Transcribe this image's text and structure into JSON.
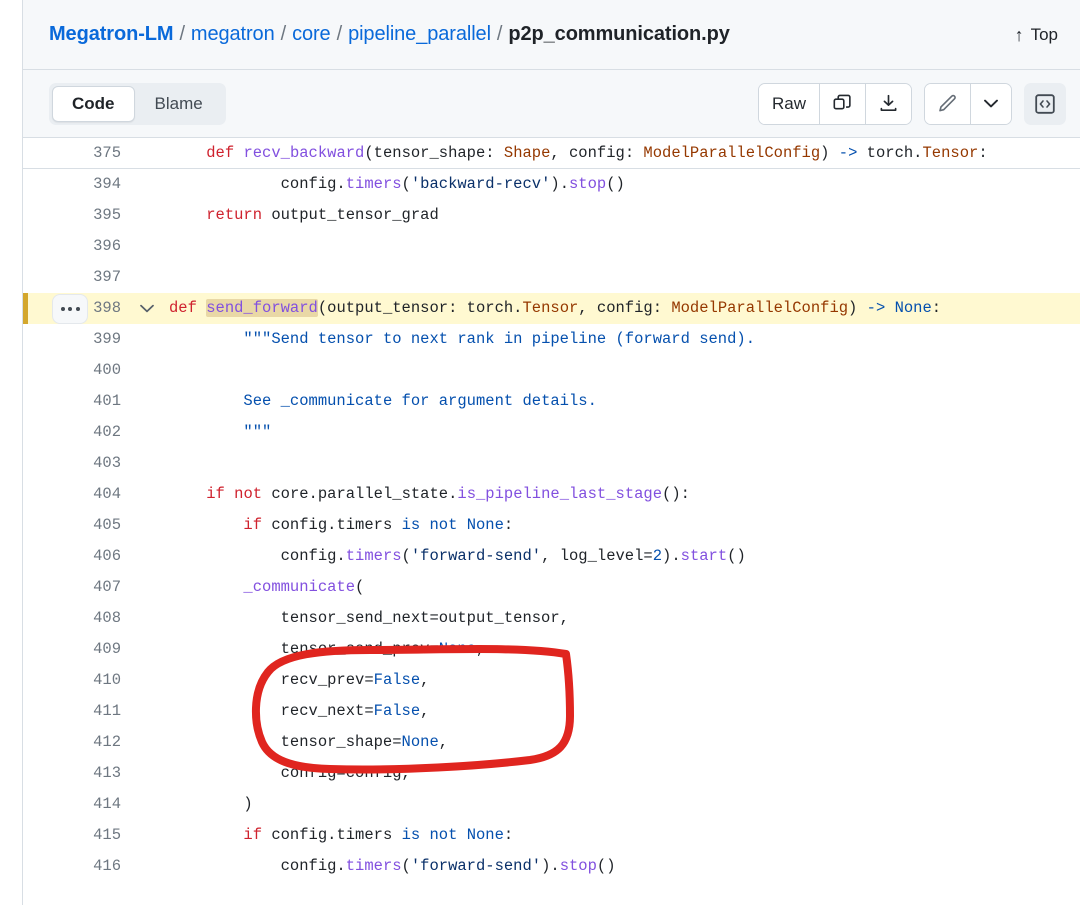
{
  "header": {
    "breadcrumb": {
      "repo": "Megatron-LM",
      "separator": "/",
      "parts": [
        "megatron",
        "core",
        "pipeline_parallel"
      ],
      "file": "p2p_communication.py"
    },
    "top_link": {
      "arrow": "↑",
      "label": "Top",
      "icon": "arrow-up-icon"
    }
  },
  "toolbar": {
    "tabs": [
      {
        "label": "Code",
        "active": true
      },
      {
        "label": "Blame",
        "active": false
      }
    ],
    "raw_label": "Raw",
    "icons": {
      "copy": "copy-icon",
      "download": "download-icon",
      "edit": "pencil-icon",
      "dropdown": "chevron-down-icon",
      "symbols": "code-brackets-icon"
    }
  },
  "code": {
    "language": "python",
    "lines": [
      {
        "n": "375",
        "gap_after": true,
        "tokens": [
          {
            "t": "    ",
            "c": "plain"
          },
          {
            "t": "def",
            "c": "kw"
          },
          {
            "t": " ",
            "c": "plain"
          },
          {
            "t": "recv_backward",
            "c": "fn"
          },
          {
            "t": "(tensor_shape: ",
            "c": "plain"
          },
          {
            "t": "Shape",
            "c": "type"
          },
          {
            "t": ", config: ",
            "c": "plain"
          },
          {
            "t": "ModelParallelConfig",
            "c": "type"
          },
          {
            "t": ") ",
            "c": "plain"
          },
          {
            "t": "->",
            "c": "blue"
          },
          {
            "t": " torch.",
            "c": "plain"
          },
          {
            "t": "Tensor",
            "c": "type"
          },
          {
            "t": ":",
            "c": "plain"
          }
        ]
      },
      {
        "n": "394",
        "tokens": [
          {
            "t": "            config.",
            "c": "plain"
          },
          {
            "t": "timers",
            "c": "fn"
          },
          {
            "t": "(",
            "c": "plain"
          },
          {
            "t": "'backward-recv'",
            "c": "str"
          },
          {
            "t": ").",
            "c": "plain"
          },
          {
            "t": "stop",
            "c": "fn"
          },
          {
            "t": "()",
            "c": "plain"
          }
        ]
      },
      {
        "n": "395",
        "tokens": [
          {
            "t": "    ",
            "c": "plain"
          },
          {
            "t": "return",
            "c": "kw"
          },
          {
            "t": " output_tensor_grad",
            "c": "plain"
          }
        ]
      },
      {
        "n": "396",
        "tokens": []
      },
      {
        "n": "397",
        "tokens": []
      },
      {
        "n": "398",
        "highlight": true,
        "dots": true,
        "chevron": "v",
        "tokens": [
          {
            "t": "",
            "c": "plain"
          },
          {
            "t": "def",
            "c": "kw"
          },
          {
            "t": " ",
            "c": "plain"
          },
          {
            "t": "send_forward",
            "c": "fn",
            "mark": true
          },
          {
            "t": "(output_tensor: torch.",
            "c": "plain"
          },
          {
            "t": "Tensor",
            "c": "type"
          },
          {
            "t": ", config: ",
            "c": "plain"
          },
          {
            "t": "ModelParallelConfig",
            "c": "type"
          },
          {
            "t": ") ",
            "c": "plain"
          },
          {
            "t": "->",
            "c": "blue"
          },
          {
            "t": " ",
            "c": "plain"
          },
          {
            "t": "None",
            "c": "blue"
          },
          {
            "t": ":",
            "c": "plain"
          }
        ]
      },
      {
        "n": "399",
        "tokens": [
          {
            "t": "        ",
            "c": "plain"
          },
          {
            "t": "\"\"\"Send tensor to next rank in pipeline (forward send).",
            "c": "blue"
          }
        ]
      },
      {
        "n": "400",
        "tokens": []
      },
      {
        "n": "401",
        "tokens": [
          {
            "t": "        ",
            "c": "plain"
          },
          {
            "t": "See _communicate for argument details.",
            "c": "blue"
          }
        ]
      },
      {
        "n": "402",
        "tokens": [
          {
            "t": "        ",
            "c": "plain"
          },
          {
            "t": "\"\"\"",
            "c": "blue"
          }
        ]
      },
      {
        "n": "403",
        "tokens": []
      },
      {
        "n": "404",
        "tokens": [
          {
            "t": "    ",
            "c": "plain"
          },
          {
            "t": "if",
            "c": "kw"
          },
          {
            "t": " ",
            "c": "plain"
          },
          {
            "t": "not",
            "c": "kw"
          },
          {
            "t": " core.parallel_state.",
            "c": "plain"
          },
          {
            "t": "is_pipeline_last_stage",
            "c": "fn"
          },
          {
            "t": "():",
            "c": "plain"
          }
        ]
      },
      {
        "n": "405",
        "tokens": [
          {
            "t": "        ",
            "c": "plain"
          },
          {
            "t": "if",
            "c": "kw"
          },
          {
            "t": " config.timers ",
            "c": "plain"
          },
          {
            "t": "is",
            "c": "blue"
          },
          {
            "t": " ",
            "c": "plain"
          },
          {
            "t": "not",
            "c": "blue"
          },
          {
            "t": " ",
            "c": "plain"
          },
          {
            "t": "None",
            "c": "blue"
          },
          {
            "t": ":",
            "c": "plain"
          }
        ]
      },
      {
        "n": "406",
        "tokens": [
          {
            "t": "            config.",
            "c": "plain"
          },
          {
            "t": "timers",
            "c": "fn"
          },
          {
            "t": "(",
            "c": "plain"
          },
          {
            "t": "'forward-send'",
            "c": "str"
          },
          {
            "t": ", log_level=",
            "c": "plain"
          },
          {
            "t": "2",
            "c": "num"
          },
          {
            "t": ").",
            "c": "plain"
          },
          {
            "t": "start",
            "c": "fn"
          },
          {
            "t": "()",
            "c": "plain"
          }
        ]
      },
      {
        "n": "407",
        "tokens": [
          {
            "t": "        ",
            "c": "plain"
          },
          {
            "t": "_communicate",
            "c": "fn"
          },
          {
            "t": "(",
            "c": "plain"
          }
        ]
      },
      {
        "n": "408",
        "tokens": [
          {
            "t": "            tensor_send_next=output_tensor,",
            "c": "plain"
          }
        ]
      },
      {
        "n": "409",
        "tokens": [
          {
            "t": "            tensor_send_prev=",
            "c": "plain"
          },
          {
            "t": "None",
            "c": "blue"
          },
          {
            "t": ",",
            "c": "plain"
          }
        ]
      },
      {
        "n": "410",
        "tokens": [
          {
            "t": "            recv_prev=",
            "c": "plain"
          },
          {
            "t": "False",
            "c": "blue"
          },
          {
            "t": ",",
            "c": "plain"
          }
        ]
      },
      {
        "n": "411",
        "tokens": [
          {
            "t": "            recv_next=",
            "c": "plain"
          },
          {
            "t": "False",
            "c": "blue"
          },
          {
            "t": ",",
            "c": "plain"
          }
        ]
      },
      {
        "n": "412",
        "tokens": [
          {
            "t": "            tensor_shape=",
            "c": "plain"
          },
          {
            "t": "None",
            "c": "blue"
          },
          {
            "t": ",",
            "c": "plain"
          }
        ]
      },
      {
        "n": "413",
        "tokens": [
          {
            "t": "            config=config,",
            "c": "plain"
          }
        ]
      },
      {
        "n": "414",
        "tokens": [
          {
            "t": "        )",
            "c": "plain"
          }
        ]
      },
      {
        "n": "415",
        "tokens": [
          {
            "t": "        ",
            "c": "plain"
          },
          {
            "t": "if",
            "c": "kw"
          },
          {
            "t": " config.timers ",
            "c": "plain"
          },
          {
            "t": "is",
            "c": "blue"
          },
          {
            "t": " ",
            "c": "plain"
          },
          {
            "t": "not",
            "c": "blue"
          },
          {
            "t": " ",
            "c": "plain"
          },
          {
            "t": "None",
            "c": "blue"
          },
          {
            "t": ":",
            "c": "plain"
          }
        ]
      },
      {
        "n": "416",
        "tokens": [
          {
            "t": "            config.",
            "c": "plain"
          },
          {
            "t": "timers",
            "c": "fn"
          },
          {
            "t": "(",
            "c": "plain"
          },
          {
            "t": "'forward-send'",
            "c": "str"
          },
          {
            "t": ").",
            "c": "plain"
          },
          {
            "t": "stop",
            "c": "fn"
          },
          {
            "t": "()",
            "c": "plain"
          }
        ]
      }
    ]
  },
  "annotation": {
    "type": "hand-drawn-ellipse",
    "color": "#e0251f",
    "stroke_width": 8,
    "encircled_lines": [
      "409",
      "410",
      "411"
    ]
  },
  "colors": {
    "link": "#0969da",
    "text": "#1f2328",
    "muted": "#6e7781",
    "border": "#d8dee4",
    "header_bg": "#f6f8fa",
    "highlight_bg": "#fff8c5",
    "mark_bg": "#e9d8a6"
  }
}
